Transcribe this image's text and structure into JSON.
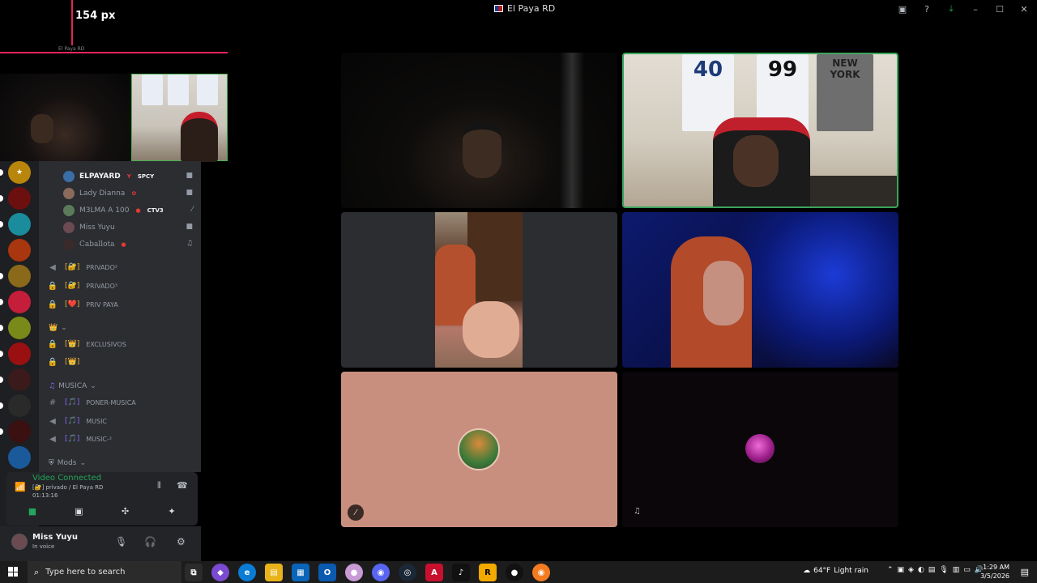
{
  "window": {
    "title": "El Paya RD"
  },
  "overlay": {
    "measure_label": "154 px",
    "mini_title": "El Paya RD"
  },
  "members": [
    {
      "name": "ELPAYARD",
      "tag": "SPCY",
      "status_icon": "camera-icon",
      "avatar_color": "#3a6ea5"
    },
    {
      "name": "Lady Dianna",
      "tag": "",
      "status_icon": "camera-icon",
      "avatar_color": "#8a6a5a"
    },
    {
      "name": "M3LMA A 100",
      "tag": "CTV3",
      "status_icon": "mic-off-icon",
      "avatar_color": "#5a7a5a"
    },
    {
      "name": "Miss Yuyu",
      "tag": "",
      "status_icon": "camera-icon",
      "avatar_color": "#6b4a52"
    },
    {
      "name": "Caballota",
      "tag": "",
      "status_icon": "headphones-off-icon",
      "avatar_color": "#3a2a2a"
    }
  ],
  "channels": [
    {
      "type": "voice",
      "badge": "[🔐]",
      "name": "privado²"
    },
    {
      "type": "locked",
      "badge": "[🔐]",
      "name": "privado³"
    },
    {
      "type": "locked",
      "badge": "[❤️]",
      "name": "priv paya"
    },
    {
      "type": "locked",
      "badge": "[👑]",
      "name": "exclusivos"
    },
    {
      "type": "locked",
      "badge": "[👑]",
      "name": ""
    },
    {
      "type": "text",
      "badge": "[🎵]",
      "name": "poner-musica"
    },
    {
      "type": "voice",
      "badge": "[🎵]",
      "name": "music"
    },
    {
      "type": "voice",
      "badge": "[🎵]",
      "name": "music-²"
    }
  ],
  "categories": {
    "crown": "👑",
    "musica": "MUSICA",
    "mods": "Mods"
  },
  "voice": {
    "status": "Video Connected",
    "location": "[🔐] privado / El Paya RD",
    "elapsed": "01:13:16"
  },
  "user": {
    "name": "Miss Yuyu",
    "status": "In voice"
  },
  "taskbar": {
    "search_placeholder": "Type here to search",
    "weather_temp": "64°F",
    "weather_desc": "Light rain",
    "time": "1:29 AM",
    "date": "3/5/2026"
  },
  "colors": {
    "accent": "#e5245b",
    "speaking": "#3ba55c",
    "connected": "#23a55a"
  }
}
